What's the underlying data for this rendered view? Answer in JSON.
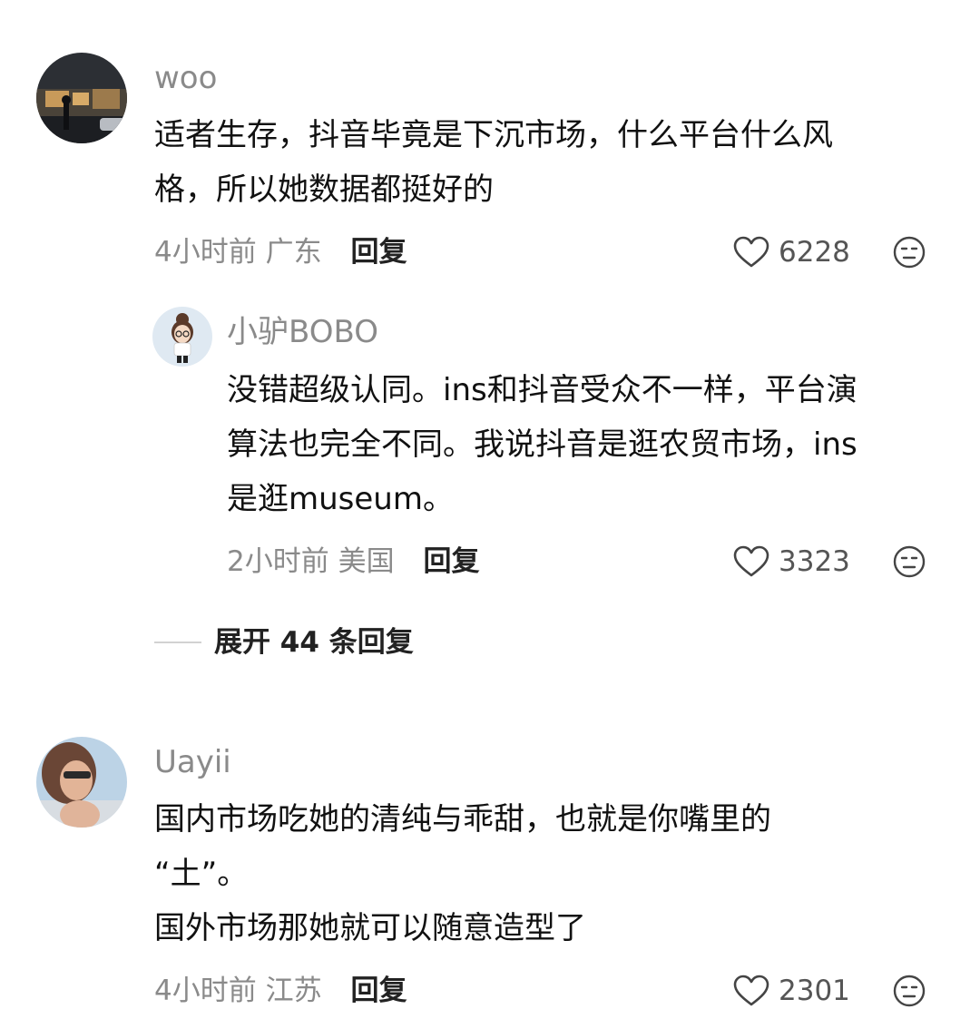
{
  "comments": [
    {
      "username": "woo",
      "lines": [
        "适者生存，抖音毕竟是下沉市场，什么平台什么风",
        "格，所以她数据都挺好的"
      ],
      "time": "4小时前",
      "location": "广东",
      "reply_label": "回复",
      "likes": "6228",
      "replies": [
        {
          "username": "小驴BOBO",
          "lines": [
            "没错超级认同。ins和抖音受众不一样，平台演",
            "算法也完全不同。我说抖音是逛农贸市场，ins",
            "是逛museum。"
          ],
          "time": "2小时前",
          "location": "美国",
          "reply_label": "回复",
          "likes": "3323"
        }
      ],
      "expand_label": "展开 44 条回复"
    },
    {
      "username": "Uayii",
      "lines": [
        "国内市场吃她的清纯与乖甜，也就是你嘴里的",
        "“土”。",
        "国外市场那她就可以随意造型了"
      ],
      "time": "4小时前",
      "location": "江苏",
      "reply_label": "回复",
      "likes": "2301"
    }
  ],
  "icons": {
    "like": "heart-outline-icon",
    "dislike": "meh-face-icon"
  },
  "colors": {
    "username": "#8a8a8a",
    "body": "#111111",
    "meta": "#8a8a8a",
    "reply": "#222222",
    "icon": "#555555"
  }
}
